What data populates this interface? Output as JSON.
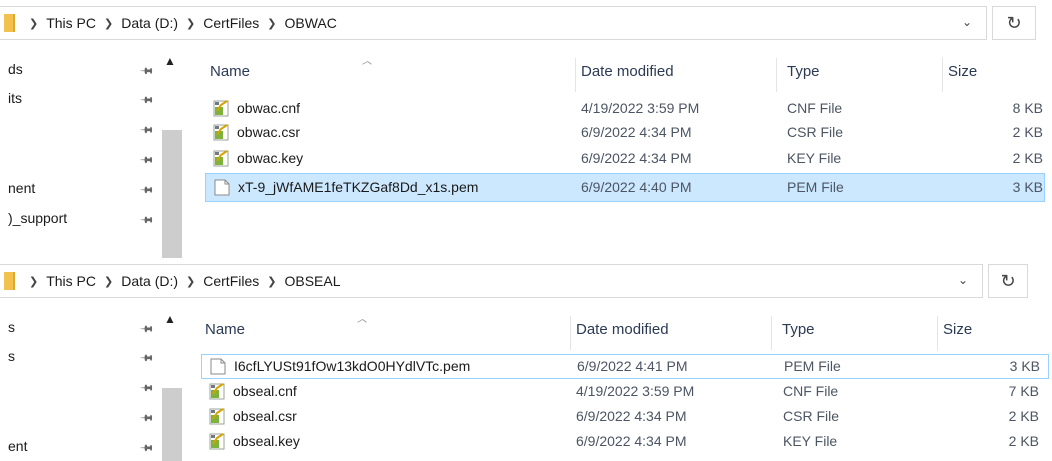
{
  "panels": [
    {
      "address": {
        "crumbs": [
          "This PC",
          "Data (D:)",
          "CertFiles",
          "OBWAC"
        ]
      },
      "nav": [
        "ds",
        "its",
        "",
        "",
        "nent",
        ")_support"
      ],
      "columns": {
        "name": "Name",
        "date": "Date modified",
        "type": "Type",
        "size": "Size"
      },
      "files": [
        {
          "name": "obwac.cnf",
          "date": "4/19/2022 3:59 PM",
          "type": "CNF File",
          "size": "8 KB",
          "icon": "config-file-icon"
        },
        {
          "name": "obwac.csr",
          "date": "6/9/2022 4:34 PM",
          "type": "CSR File",
          "size": "2 KB",
          "icon": "config-file-icon"
        },
        {
          "name": "obwac.key",
          "date": "6/9/2022 4:34 PM",
          "type": "KEY File",
          "size": "2 KB",
          "icon": "config-file-icon"
        },
        {
          "name": "xT-9_jWfAME1feTKZGaf8Dd_x1s.pem",
          "date": "6/9/2022 4:40 PM",
          "type": "PEM File",
          "size": "3 KB",
          "icon": "blank-file-icon"
        }
      ]
    },
    {
      "address": {
        "crumbs": [
          "This PC",
          "Data (D:)",
          "CertFiles",
          "OBSEAL"
        ]
      },
      "nav": [
        "s",
        "s",
        "",
        "ent"
      ],
      "columns": {
        "name": "Name",
        "date": "Date modified",
        "type": "Type",
        "size": "Size"
      },
      "files": [
        {
          "name": "I6cfLYUSt91fOw13kdO0HYdlVTc.pem",
          "date": "6/9/2022 4:41 PM",
          "type": "PEM File",
          "size": "3 KB",
          "icon": "blank-file-icon"
        },
        {
          "name": "obseal.cnf",
          "date": "4/19/2022 3:59 PM",
          "type": "CNF File",
          "size": "7 KB",
          "icon": "config-file-icon"
        },
        {
          "name": "obseal.csr",
          "date": "6/9/2022 4:34 PM",
          "type": "CSR File",
          "size": "2 KB",
          "icon": "config-file-icon"
        },
        {
          "name": "obseal.key",
          "date": "6/9/2022 4:34 PM",
          "type": "KEY File",
          "size": "2 KB",
          "icon": "config-file-icon"
        }
      ]
    }
  ]
}
